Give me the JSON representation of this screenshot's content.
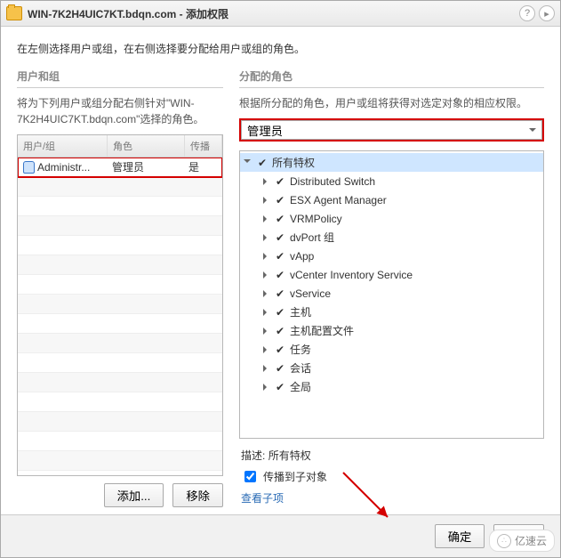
{
  "title": "WIN-7K2H4UIC7KT.bdqn.com - 添加权限",
  "intro": "在左侧选择用户或组，在右侧选择要分配给用户或组的角色。",
  "left": {
    "heading": "用户和组",
    "desc": "将为下列用户或组分配右侧针对\"WIN-7K2H4UIC7KT.bdqn.com\"选择的角色。",
    "headers": {
      "user": "用户/组",
      "role": "角色",
      "prop": "传播"
    },
    "rows": [
      {
        "user": "Administr...",
        "role": "管理员",
        "prop": "是"
      }
    ],
    "add": "添加...",
    "remove": "移除"
  },
  "right": {
    "heading": "分配的角色",
    "desc": "根据所分配的角色，用户或组将获得对选定对象的相应权限。",
    "select_value": "管理员",
    "tree": [
      {
        "label": "所有特权",
        "open": true,
        "selected": true,
        "level": 0
      },
      {
        "label": "Distributed Switch",
        "open": false,
        "level": 1
      },
      {
        "label": "ESX Agent Manager",
        "open": false,
        "level": 1
      },
      {
        "label": "VRMPolicy",
        "open": false,
        "level": 1
      },
      {
        "label": "dvPort 组",
        "open": false,
        "level": 1
      },
      {
        "label": "vApp",
        "open": false,
        "level": 1
      },
      {
        "label": "vCenter Inventory Service",
        "open": false,
        "level": 1
      },
      {
        "label": "vService",
        "open": false,
        "level": 1
      },
      {
        "label": "主机",
        "open": false,
        "level": 1
      },
      {
        "label": "主机配置文件",
        "open": false,
        "level": 1
      },
      {
        "label": "任务",
        "open": false,
        "level": 1
      },
      {
        "label": "会话",
        "open": false,
        "level": 1
      },
      {
        "label": "全局",
        "open": false,
        "level": 1
      }
    ],
    "desc_label": "描述:",
    "desc_value": "所有特权",
    "prop_checked": true,
    "prop_label": "传播到子对象",
    "view_children": "查看子项"
  },
  "footer": {
    "ok": "确定",
    "cancel": "取消"
  },
  "watermark": "亿速云"
}
